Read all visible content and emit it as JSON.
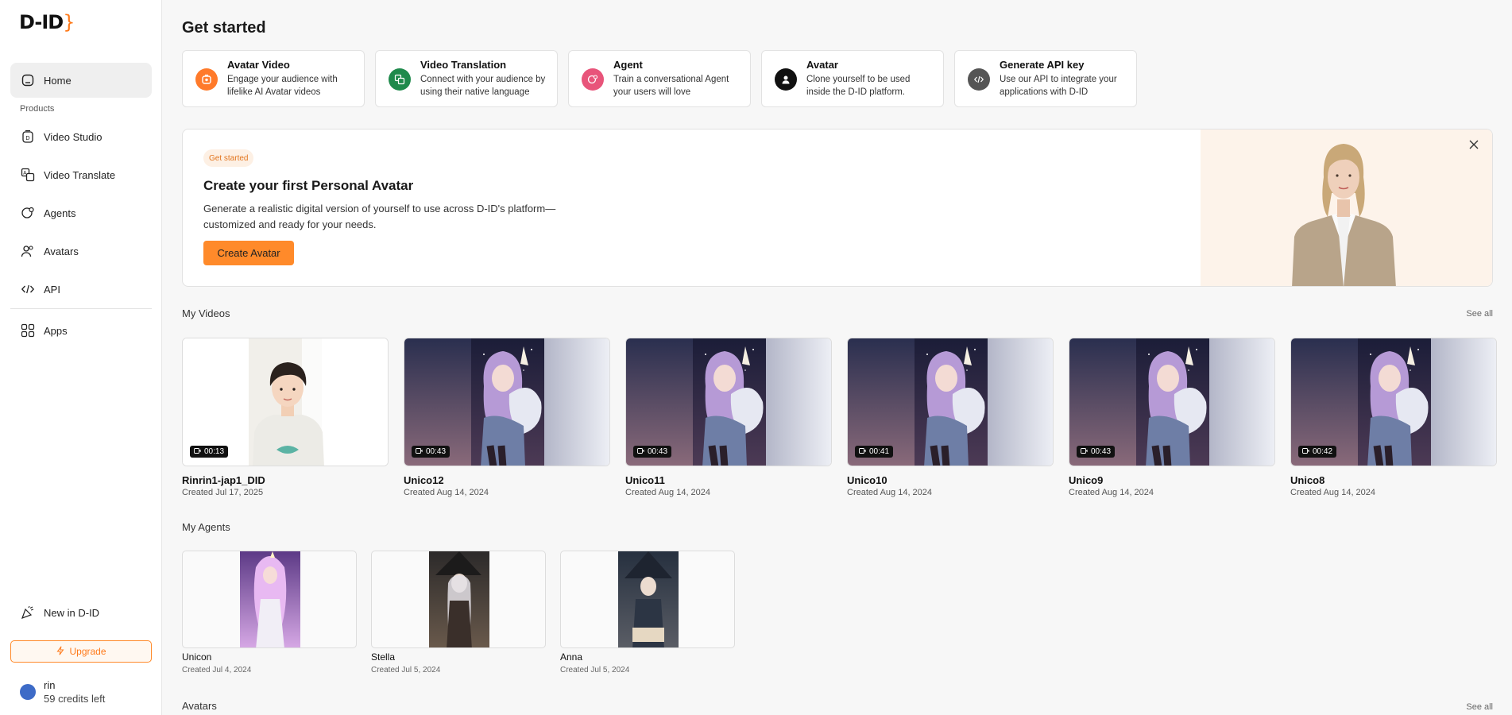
{
  "brand": {
    "logo_text": "D-ID",
    "accent": "#ff8a2a"
  },
  "sidebar": {
    "home": "Home",
    "section_products": "Products",
    "items": [
      {
        "label": "Video Studio",
        "icon": "video-studio-icon"
      },
      {
        "label": "Video Translate",
        "icon": "translate-icon"
      },
      {
        "label": "Agents",
        "icon": "agents-icon"
      },
      {
        "label": "Avatars",
        "icon": "avatars-icon"
      },
      {
        "label": "API",
        "icon": "code-icon"
      }
    ],
    "apps": "Apps",
    "new_in": "New in D-ID",
    "upgrade": "Upgrade",
    "user": {
      "name": "rin",
      "credits": "59 credits left"
    }
  },
  "main": {
    "title": "Get started",
    "quick_actions": [
      {
        "title": "Avatar Video",
        "desc": "Engage your audience with lifelike AI Avatar videos",
        "icon": "avatar-video-icon",
        "color": "#ff7a2a"
      },
      {
        "title": "Video Translation",
        "desc": "Connect with your audience by using their native language",
        "icon": "translation-icon",
        "color": "#1f8a4c"
      },
      {
        "title": "Agent",
        "desc": "Train a conversational Agent your users will love",
        "icon": "agent-chat-icon",
        "color": "#e8547a"
      },
      {
        "title": "Avatar",
        "desc": "Clone yourself to be used inside the D-ID platform.",
        "icon": "person-icon",
        "color": "#111111"
      },
      {
        "title": "Generate API key",
        "desc": "Use our API to integrate your applications with D-ID",
        "icon": "api-key-icon",
        "color": "#555555"
      }
    ],
    "banner": {
      "tag": "Get started",
      "title": "Create your first Personal Avatar",
      "desc": "Generate a realistic digital version of yourself to use across D-ID's platform—customized and ready for your needs.",
      "cta": "Create Avatar"
    },
    "my_videos": {
      "title": "My Videos",
      "see_all": "See all",
      "items": [
        {
          "name": "Rinrin1-jap1_DID",
          "date": "Created Jul 17, 2025",
          "duration": "00:13",
          "thumb": "boy"
        },
        {
          "name": "Unico12",
          "date": "Created Aug 14, 2024",
          "duration": "00:43",
          "thumb": "unicorn"
        },
        {
          "name": "Unico11",
          "date": "Created Aug 14, 2024",
          "duration": "00:43",
          "thumb": "unicorn"
        },
        {
          "name": "Unico10",
          "date": "Created Aug 14, 2024",
          "duration": "00:41",
          "thumb": "unicorn"
        },
        {
          "name": "Unico9",
          "date": "Created Aug 14, 2024",
          "duration": "00:43",
          "thumb": "unicorn"
        },
        {
          "name": "Unico8",
          "date": "Created Aug 14, 2024",
          "duration": "00:42",
          "thumb": "unicorn"
        }
      ]
    },
    "my_agents": {
      "title": "My Agents",
      "items": [
        {
          "name": "Unicon",
          "date": "Created Jul 4, 2024",
          "thumb": "unicorn-girl"
        },
        {
          "name": "Stella",
          "date": "Created Jul 5, 2024",
          "thumb": "witch"
        },
        {
          "name": "Anna",
          "date": "Created Jul 5, 2024",
          "thumb": "witch-book"
        }
      ]
    },
    "avatars": {
      "title": "Avatars",
      "see_all": "See all"
    }
  }
}
